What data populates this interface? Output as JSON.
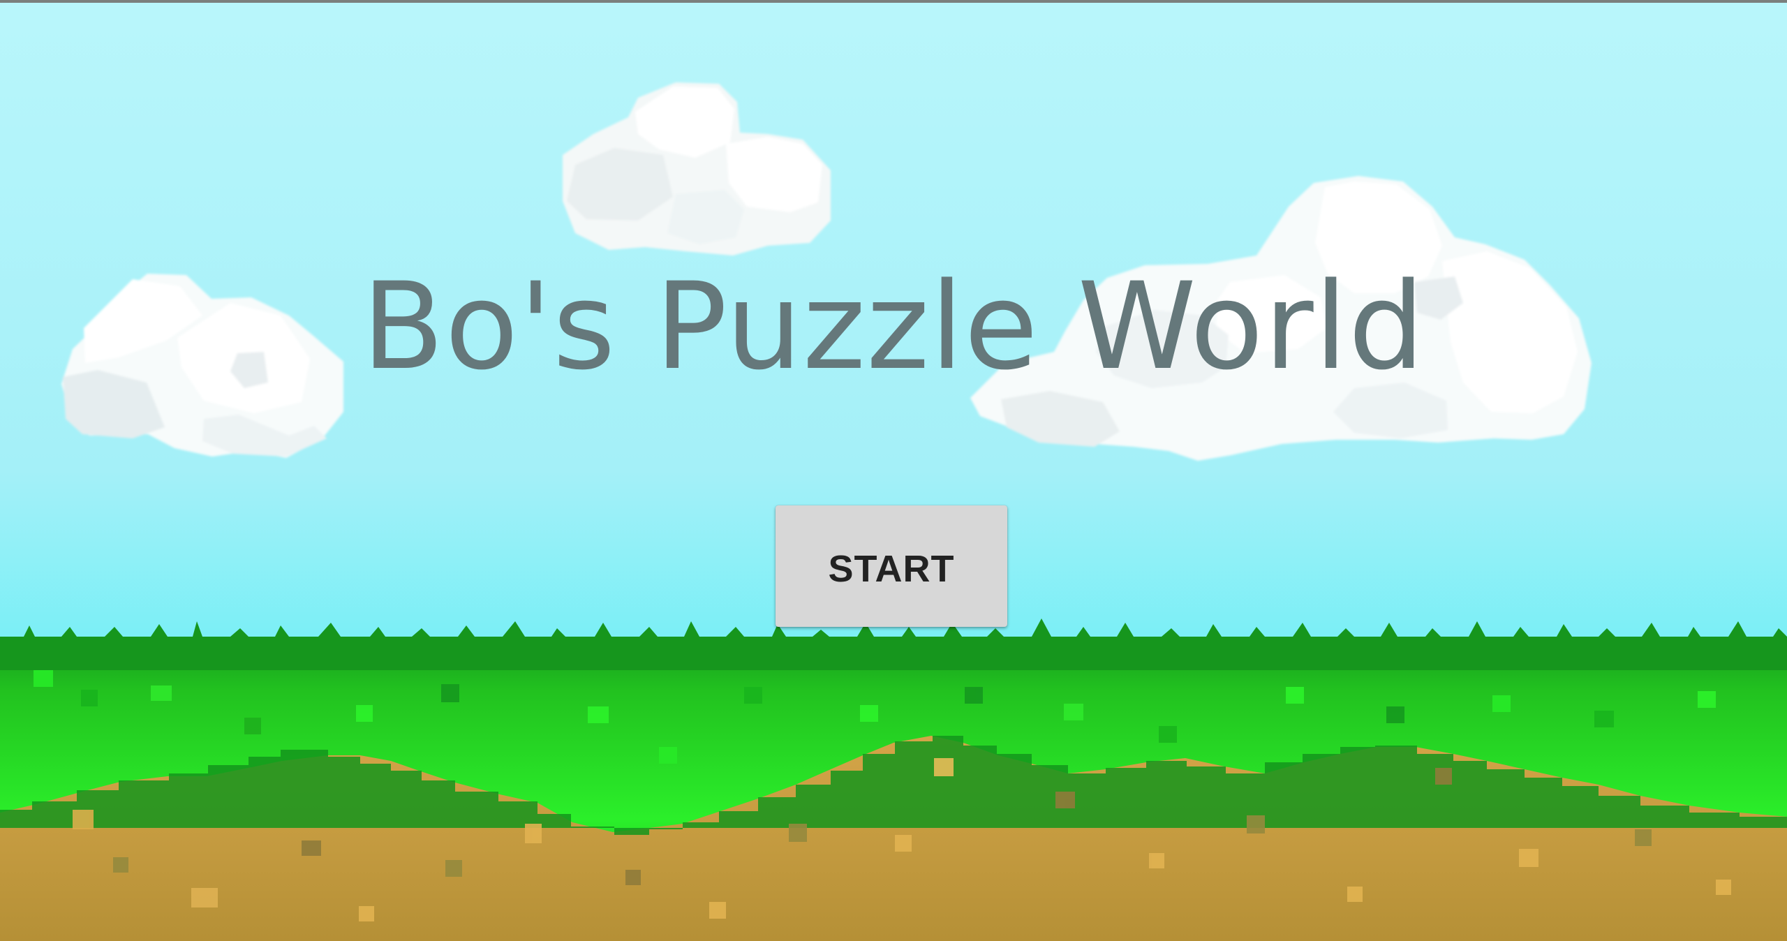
{
  "game": {
    "title": "Bo's Puzzle World",
    "start_button": "START"
  },
  "colors": {
    "sky_top": "#b8f5fb",
    "sky_bottom": "#6ff0f6",
    "cloud_light": "#ffffff",
    "cloud_shadow": "#e4ecef",
    "grass_dark": "#16991f",
    "grass": "#20cc1e",
    "grass_bright": "#2cf02a",
    "dirt": "#c79a3d",
    "dirt_light": "#e1b251",
    "dirt_dark": "#8f7b3a",
    "title": "#65787b",
    "button": "#d7d7d7",
    "button_text": "#222222"
  }
}
